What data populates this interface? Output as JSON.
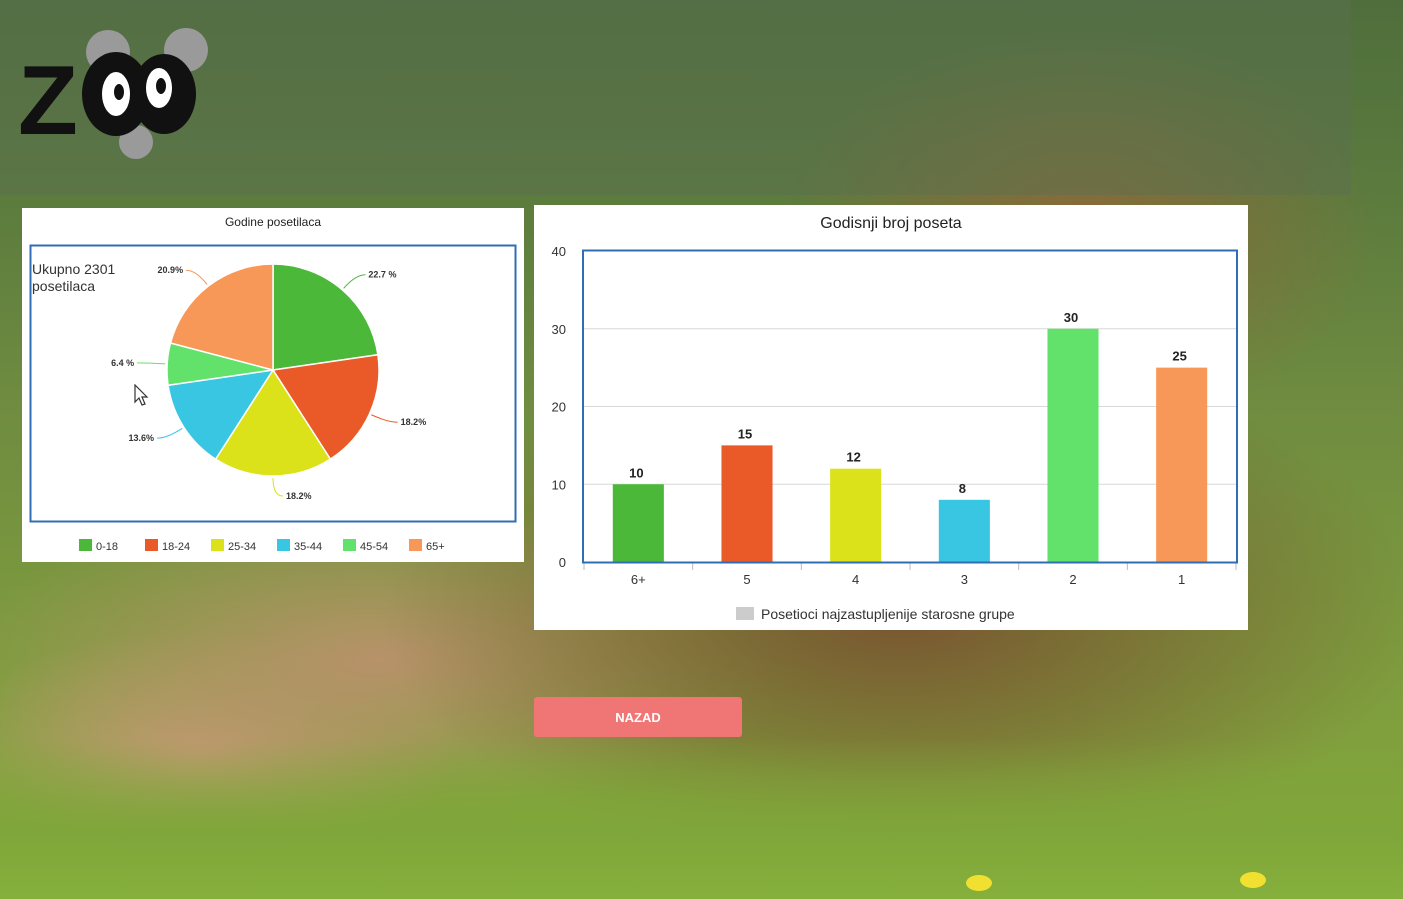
{
  "pie_chart": {
    "title": "Godine posetilaca",
    "total_label": "Ukupno 2301\nposetilaca",
    "legend": [
      "0-18",
      "18-24",
      "25-34",
      "35-44",
      "45-54",
      "65+"
    ],
    "colors": [
      "#4cb83a",
      "#ea5a28",
      "#dce21a",
      "#39c6e3",
      "#63e26b",
      "#f89858"
    ]
  },
  "bar_chart": {
    "title": "Godisnji broj poseta",
    "legend": "Posetioci najzastupljenije starosne grupe",
    "colors": [
      "#4cb83a",
      "#ea5a28",
      "#dce21a",
      "#39c6e3",
      "#63e26b",
      "#f89858"
    ]
  },
  "actions": {
    "back_label": "NAZAD"
  },
  "chart_data": [
    {
      "type": "pie",
      "title": "Godine posetilaca",
      "categories": [
        "0-18",
        "18-24",
        "25-34",
        "35-44",
        "45-54",
        "65+"
      ],
      "values": [
        22.7,
        18.2,
        18.2,
        13.6,
        6.4,
        20.9
      ],
      "labels": [
        "22.7 %",
        "18.2%",
        "18.2%",
        "13.6%",
        "6.4 %",
        "20.9%"
      ],
      "legend_position": "bottom"
    },
    {
      "type": "bar",
      "title": "Godisnji broj poseta",
      "categories": [
        "6+",
        "5",
        "4",
        "3",
        "2",
        "1"
      ],
      "values": [
        10,
        15,
        12,
        8,
        30,
        25
      ],
      "ylim": [
        0,
        40
      ],
      "yticks": [
        0,
        10,
        20,
        30,
        40
      ],
      "grid": true,
      "legend": "Posetioci najzastupljenije starosne grupe",
      "legend_position": "bottom"
    }
  ]
}
